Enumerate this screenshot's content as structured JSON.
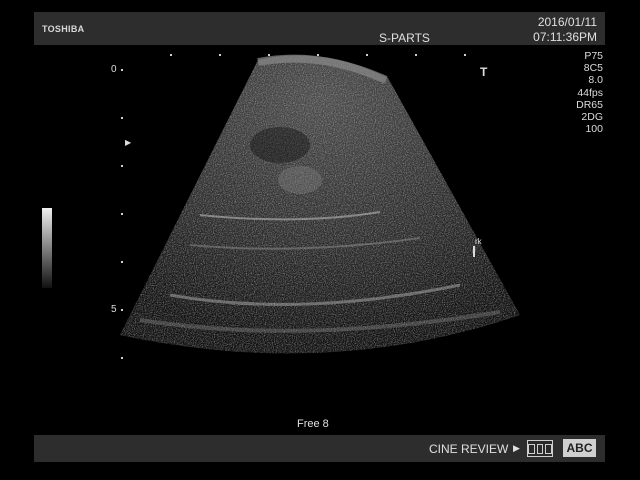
{
  "header": {
    "brand": "TOSHIBA",
    "preset": "S-PARTS",
    "date": "2016/01/11",
    "time": "07:11:36PM"
  },
  "params": [
    "P75",
    "8C5",
    "8.0",
    "44fps",
    "DR65",
    "2DG",
    "100"
  ],
  "depth": {
    "zero": "0",
    "five": "5"
  },
  "markers": {
    "probe_mark": "T",
    "annotation": "rk"
  },
  "footer": {
    "body_mark": "Free 8",
    "cine_label": "CINE REVIEW",
    "abc_label": "ABC"
  },
  "icons": {
    "play": "play-triangle-icon",
    "cine": "cine-frames-icon",
    "focus": "focus-arrow-icon"
  }
}
